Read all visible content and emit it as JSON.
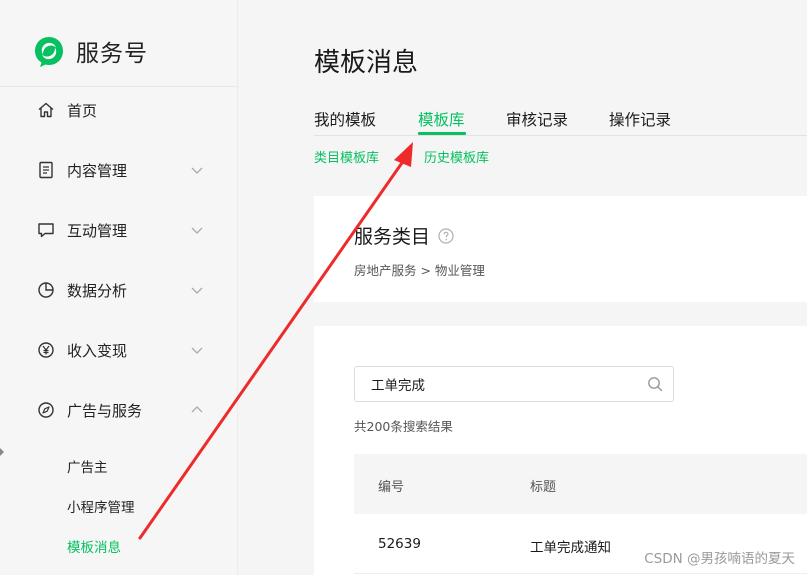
{
  "brand": {
    "name": "服务号",
    "logo_icon": "wechat-service-logo",
    "logo_color": "#07c160"
  },
  "sidebar": {
    "items": [
      {
        "label": "首页",
        "icon": "home-icon",
        "expandable": false
      },
      {
        "label": "内容管理",
        "icon": "document-icon",
        "expandable": true,
        "expanded": false
      },
      {
        "label": "互动管理",
        "icon": "chat-icon",
        "expandable": true,
        "expanded": false
      },
      {
        "label": "数据分析",
        "icon": "pie-chart-icon",
        "expandable": true,
        "expanded": false
      },
      {
        "label": "收入变现",
        "icon": "yen-icon",
        "expandable": true,
        "expanded": false
      },
      {
        "label": "广告与服务",
        "icon": "compass-icon",
        "expandable": true,
        "expanded": true
      }
    ],
    "sub_items": [
      {
        "label": "广告主",
        "active": false
      },
      {
        "label": "小程序管理",
        "active": false
      },
      {
        "label": "模板消息",
        "active": true
      }
    ]
  },
  "main": {
    "title": "模板消息",
    "tabs": [
      {
        "label": "我的模板",
        "active": false
      },
      {
        "label": "模板库",
        "active": true
      },
      {
        "label": "审核记录",
        "active": false
      },
      {
        "label": "操作记录",
        "active": false
      }
    ],
    "subtabs": [
      "类目模板库",
      "历史模板库"
    ],
    "category": {
      "title": "服务类目",
      "breadcrumb": "房地产服务 > 物业管理"
    },
    "search": {
      "value": "工单完成",
      "placeholder": ""
    },
    "result_count": "共200条搜索结果",
    "table": {
      "headers": [
        "编号",
        "标题"
      ],
      "rows": [
        {
          "id": "52639",
          "title": "工单完成通知"
        }
      ]
    }
  },
  "watermark": "CSDN @男孩喃语的夏天",
  "colors": {
    "accent": "#07c160",
    "annotation_arrow": "#ee2a2a"
  }
}
